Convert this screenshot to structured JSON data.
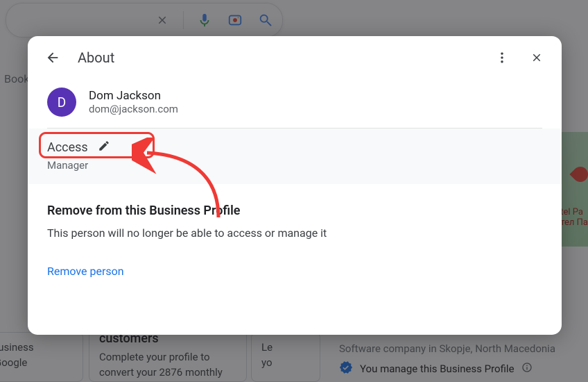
{
  "search": {
    "clear_name": "clear",
    "mic_name": "voice-search",
    "lens_name": "image-search",
    "search_name": "search"
  },
  "bg": {
    "tabs_overview": "Books",
    "map_label_line1": "tel Pa",
    "map_label_line2": "тел Па",
    "card_a_line1": "r business",
    "card_a_line2": "n Google",
    "card_b_title": "customers",
    "card_b_line1": "Complete your profile to",
    "card_b_line2": "convert your 2876 monthly",
    "card_c_line1": "Le",
    "card_c_line2": "yo",
    "subtitle": "Software company in Skopje, North Macedonia",
    "manage_text": "You manage this Business Profile"
  },
  "modal": {
    "title": "About",
    "user": {
      "initial": "D",
      "name": "Dom Jackson",
      "email": "dom@jackson.com"
    },
    "access": {
      "label": "Access",
      "role": "Manager"
    },
    "remove": {
      "title": "Remove from this Business Profile",
      "desc": "This person will no longer be able to access or manage it",
      "link": "Remove person"
    }
  },
  "colors": {
    "annotation": "#ef3a35",
    "link": "#1a73e8",
    "avatar": "#5832b5"
  }
}
